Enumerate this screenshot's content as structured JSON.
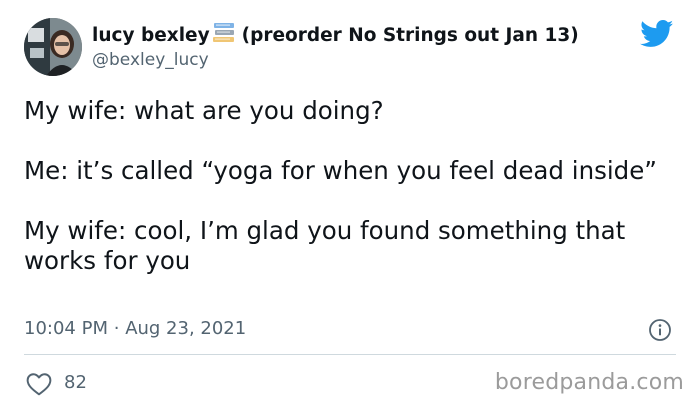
{
  "tweet": {
    "author": {
      "display_name": "lucy bexley",
      "name_suffix": "(preorder No Strings out Jan 13)",
      "handle": "@bexley_lucy",
      "name_emoji_icon": "books-icon",
      "avatar_icon": "avatar"
    },
    "platform_icon": "twitter-bird-icon",
    "text_paragraphs": [
      "My wife: what are you doing?",
      "Me: it’s called “yoga for when you feel dead inside”",
      "My wife: cool, I’m glad you found something that works for you"
    ],
    "time": "10:04 PM",
    "separator": "·",
    "date": "Aug 23, 2021",
    "info_icon": "info-icon",
    "likes": {
      "icon": "heart-icon",
      "count": "82"
    }
  },
  "watermark": "boredpanda.com",
  "colors": {
    "text": "#0f1419",
    "secondary_text": "#536471",
    "twitter_blue": "#1d9bf0",
    "divider": "#cfd9de",
    "watermark": "#9b9b9b"
  }
}
